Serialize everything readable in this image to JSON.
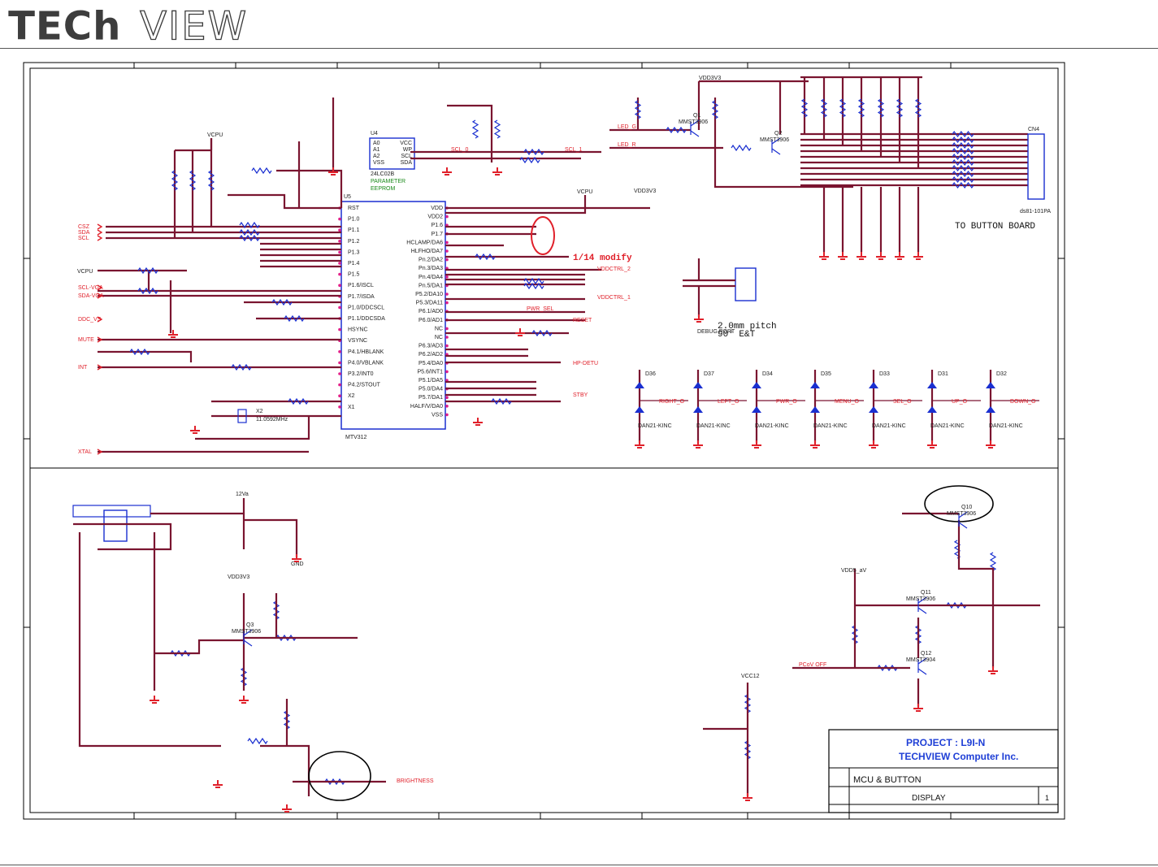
{
  "header": {
    "logo_solid": "TECh",
    "logo_outline": "VIEW"
  },
  "title_block": {
    "project": "PROJECT : L9I-N",
    "company": "TECHVIEW Computer Inc.",
    "sheet_title": "MCU & BUTTON",
    "subtitle": "DISPLAY",
    "rev": "1"
  },
  "annotations": {
    "modify": "1/14 modify",
    "to_button_board": "TO BUTTON BOARD",
    "debug_port": "DEBUG PORT",
    "pitch": "2.0mm  pitch",
    "angle": "90° E&T",
    "eeprom_label": "PARAMETER",
    "eeprom_label2": "EEPROM"
  },
  "mcu": {
    "ref": "U5",
    "part": "MTV312",
    "left_pins": [
      "RST",
      "P1.0",
      "P1.1",
      "P1.2",
      "P1.3",
      "P1.4",
      "P1.5",
      "P1.6/ISCL",
      "P1.7/ISDA",
      "P1.0/DDCSCL",
      "P1.1/DDCSDA",
      "HSYNC",
      "VSYNC",
      "P4.1/HBLANK",
      "P4.0/VBLANK",
      "P3.2/INT0",
      "P4.2/STOUT",
      "X2",
      "X1"
    ],
    "right_pins": [
      "VDD",
      "VDD2",
      "P1.6",
      "P1.7",
      "HCLAMP/DA6",
      "HLFHO/DA7",
      "Pn.2/DA2",
      "Pn.3/DA3",
      "Pn.4/DA4",
      "Pn.5/DA1",
      "P5.2/DA10",
      "P5.3/DA11",
      "P6.1/AD0",
      "P6.0/AD1",
      "NC",
      "NC",
      "P6.3/AD3",
      "P6.2/AD2",
      "P5.4/DA0",
      "P5.6/INT1",
      "P5.1/DA5",
      "P5.0/DA4",
      "P5.7/DA1",
      "HALF/V/DA0",
      "VSS"
    ]
  },
  "eeprom": {
    "ref": "U4",
    "part": "24LC02B",
    "pins_left": [
      "A0",
      "A1",
      "A2",
      "VSS"
    ],
    "pins_right": [
      "VCC",
      "WP",
      "SCL",
      "SDA"
    ]
  },
  "nets_left": [
    "CSZ",
    "SDA",
    "SCL",
    "SCL-VGA",
    "SDA-VGA",
    "DDC_VS",
    "MUTE",
    "INT",
    "XTAL"
  ],
  "nets_right": [
    "LED_G",
    "LED_R",
    "SCL_0",
    "SCL_1",
    "PWR_SEL",
    "RESET",
    "VDDCTRL_2",
    "VDDCTRL_1",
    "HP-DETU",
    "STBY",
    "BRIGHTNESS",
    "PCoV OFF"
  ],
  "power": [
    "VCPU",
    "VDD3V3",
    "VCPU",
    "VCPU",
    "VDD3V3",
    "12Va",
    "VDD3V3",
    "VDD5_aV",
    "VCC12",
    "GND"
  ],
  "connector": {
    "ref": "CN4",
    "part": "ds81-101PA"
  },
  "diodes": [
    {
      "ref": "D36",
      "part": "DAN21-KINC",
      "net": "RIGHT_O"
    },
    {
      "ref": "D37",
      "part": "DAN21-KINC",
      "net": "LEFT_O"
    },
    {
      "ref": "D34",
      "part": "DAN21-KINC",
      "net": "PWR_O"
    },
    {
      "ref": "D35",
      "part": "DAN21-KINC",
      "net": "MENU_O"
    },
    {
      "ref": "D33",
      "part": "DAN21-KINC",
      "net": "SEL_O"
    },
    {
      "ref": "D31",
      "part": "DAN21-KINC",
      "net": "UP_O"
    },
    {
      "ref": "D32",
      "part": "DAN21-KINC",
      "net": "DOWN_O"
    }
  ],
  "transistors": [
    {
      "ref": "Q1",
      "part": "MMST3906"
    },
    {
      "ref": "Q2",
      "part": "MMST3906"
    },
    {
      "ref": "Q3",
      "part": "MMST3906"
    },
    {
      "ref": "Q10",
      "part": "MMST3906"
    },
    {
      "ref": "Q11",
      "part": "MMST3906"
    },
    {
      "ref": "Q12",
      "part": "MMST3904"
    }
  ],
  "crystal": {
    "ref": "X2",
    "value": "11.0592MHz"
  },
  "colors": {
    "wire": "#7a1530",
    "component": "#1a2fd0",
    "net_label": "#e0202a",
    "pin_dot": "#e0208a"
  }
}
